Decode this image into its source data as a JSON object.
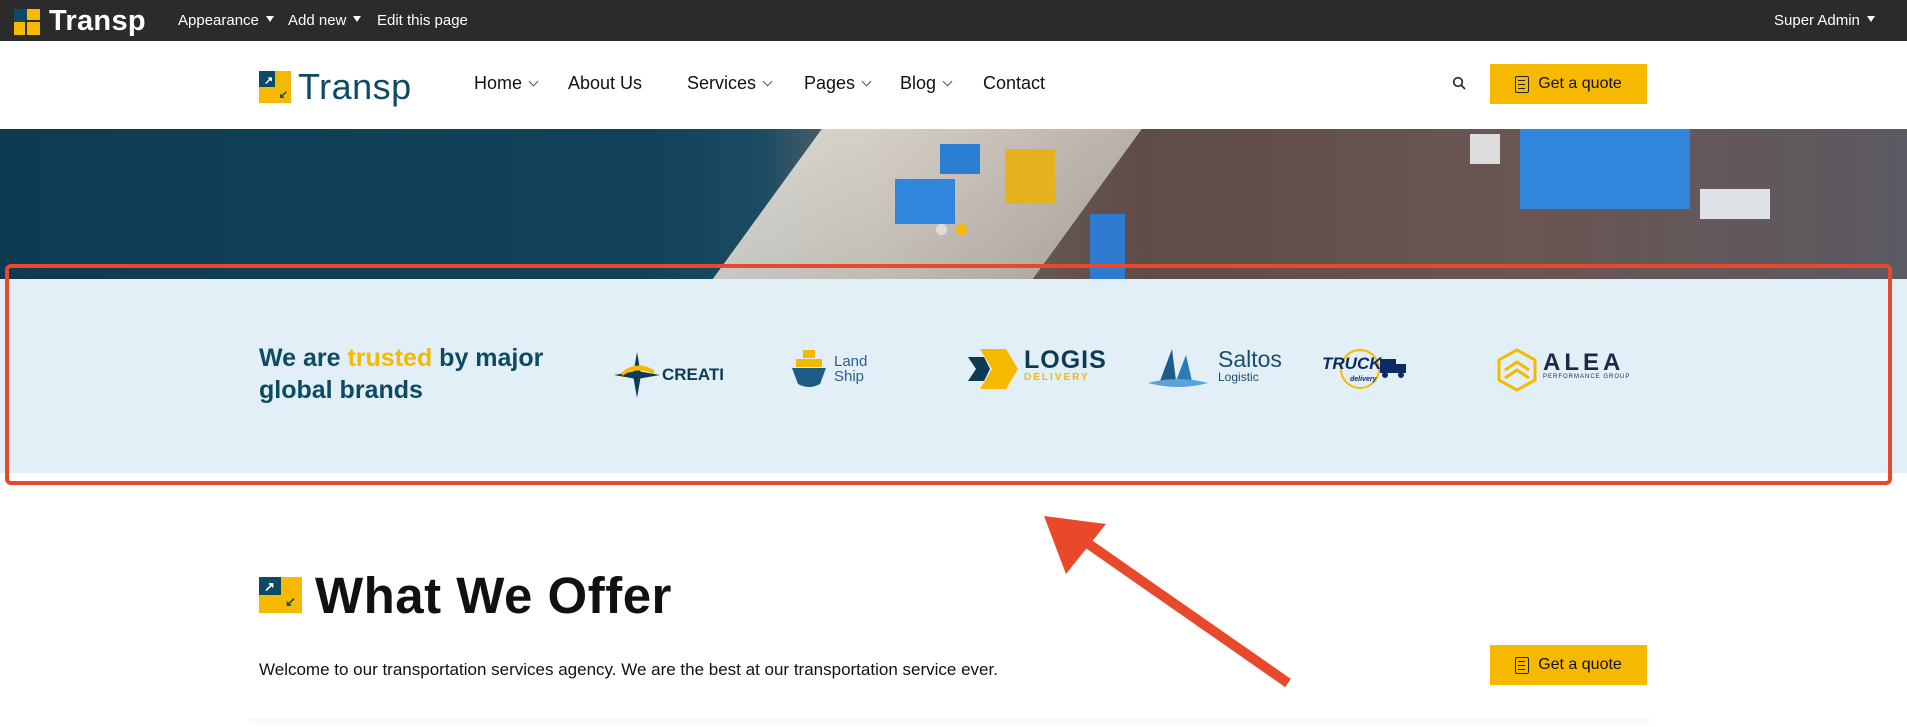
{
  "admin_bar": {
    "logo_text": "Transp",
    "menu": [
      {
        "label": "Appearance",
        "has_caret": true
      },
      {
        "label": "Add new",
        "has_caret": true
      },
      {
        "label": "Edit this page",
        "has_caret": false
      }
    ],
    "user": "Super Admin"
  },
  "header": {
    "logo_text": "Transp",
    "nav": [
      {
        "label": "Home",
        "has_dropdown": true
      },
      {
        "label": "About Us",
        "has_dropdown": false
      },
      {
        "label": "Services",
        "has_dropdown": true
      },
      {
        "label": "Pages",
        "has_dropdown": true
      },
      {
        "label": "Blog",
        "has_dropdown": true
      },
      {
        "label": "Contact",
        "has_dropdown": false
      }
    ],
    "search_icon": "search-icon",
    "quote_button": "Get a quote"
  },
  "hero": {
    "slider_dots": 2,
    "active_dot": 2
  },
  "brands": {
    "heading_prefix": "We are",
    "heading_highlight": "trusted",
    "heading_suffix": "by major global brands",
    "logos": [
      {
        "name": "CREATI"
      },
      {
        "name_line1": "Land",
        "name_line2": "Ship"
      },
      {
        "name": "LOGIS",
        "sub": "DELIVERY"
      },
      {
        "name": "Saltos",
        "sub": "Logistic"
      },
      {
        "name": "TRUCK",
        "sub": "delivery"
      },
      {
        "name": "ALEA",
        "sub": "PERFORMANCE GROUP"
      }
    ]
  },
  "offer": {
    "title": "What We Offer",
    "description": "Welcome to our transportation services agency. We are the best at our transportation service ever.",
    "quote_button": "Get a quote"
  },
  "colors": {
    "accent": "#f7b900",
    "brand_dark": "#0d4a63",
    "annotation": "#e8492b",
    "brands_bg": "#e2eff6"
  }
}
